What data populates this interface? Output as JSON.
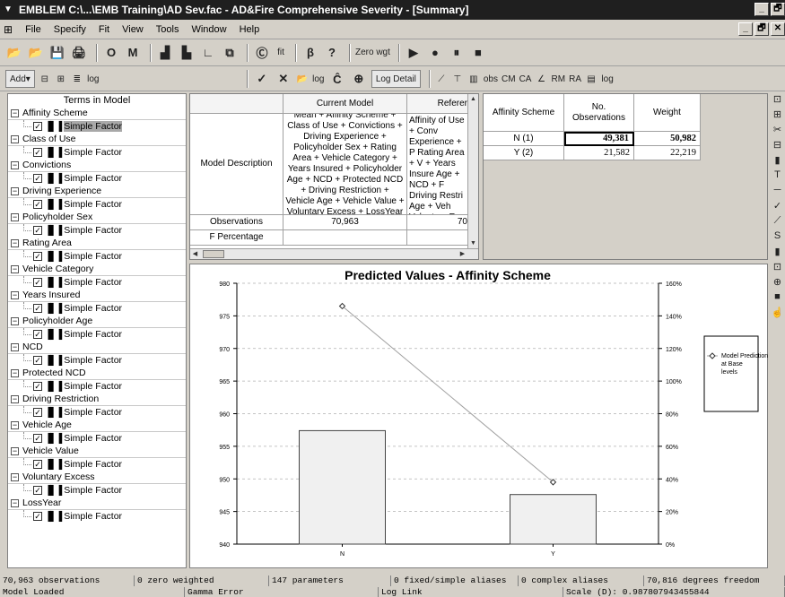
{
  "window": {
    "title": "EMBLEM C:\\...\\EMB Training\\AD Sev.fac - AD&Fire Comprehensive Severity - [Summary]",
    "controls": [
      "_",
      "🗗",
      "✕"
    ]
  },
  "menu": {
    "items": [
      "File",
      "Specify",
      "Fit",
      "View",
      "Tools",
      "Window",
      "Help"
    ],
    "mdi_controls": [
      "_",
      "🗗",
      "✕"
    ]
  },
  "toolbar1": {
    "buttons": [
      {
        "name": "open-icon",
        "glyph": "📂"
      },
      {
        "name": "open-alt-icon",
        "glyph": "📂"
      },
      {
        "name": "save-icon",
        "glyph": "💾"
      },
      {
        "name": "print-icon",
        "glyph": "🖨"
      },
      {
        "name": "o-button",
        "glyph": "O"
      },
      {
        "name": "m-button",
        "glyph": "M"
      },
      {
        "name": "chart-add-icon",
        "glyph": "▟"
      },
      {
        "name": "chart-sub-icon",
        "glyph": "▙"
      },
      {
        "name": "axis-icon",
        "glyph": "∟"
      },
      {
        "name": "copy-icon",
        "glyph": "⧉"
      },
      {
        "name": "c-button",
        "glyph": "Ⓒ"
      },
      {
        "name": "fit-button",
        "glyph": "fit"
      },
      {
        "name": "beta-icon",
        "glyph": "β"
      },
      {
        "name": "help-icon",
        "glyph": "?"
      },
      {
        "name": "zero-wgt-button",
        "glyph": "Zero wgt"
      },
      {
        "name": "play-icon",
        "glyph": "▶"
      },
      {
        "name": "record-icon",
        "glyph": "●"
      },
      {
        "name": "pause-icon",
        "glyph": "⏸"
      },
      {
        "name": "stop-icon",
        "glyph": "■"
      }
    ]
  },
  "toolbar2": {
    "add_label": "Add▾",
    "log_label": "log",
    "log_detail_label": "Log Detail",
    "obs_label": "obs",
    "cm_label": "CM",
    "ca_label": "CA",
    "rm_label": "RM",
    "ra_label": "RA",
    "log2_label": "log",
    "check_glyph": "✓",
    "cross_glyph": "✕",
    "c_hat_glyph": "Ĉ",
    "plus_glyph": "⊕"
  },
  "tree": {
    "title": "Terms in Model",
    "expander": "−",
    "check": "✓",
    "bars_glyph": "▐▌▐",
    "terms": [
      {
        "label": "Affinity Scheme",
        "child": "Simple Factor",
        "selected": true
      },
      {
        "label": "Class of Use",
        "child": "Simple Factor"
      },
      {
        "label": "Convictions",
        "child": "Simple Factor"
      },
      {
        "label": "Driving Experience",
        "child": "Simple Factor"
      },
      {
        "label": "Policyholder Sex",
        "child": "Simple Factor"
      },
      {
        "label": "Rating Area",
        "child": "Simple Factor"
      },
      {
        "label": "Vehicle Category",
        "child": "Simple Factor"
      },
      {
        "label": "Years Insured",
        "child": "Simple Factor"
      },
      {
        "label": "Policyholder Age",
        "child": "Simple Factor"
      },
      {
        "label": "NCD",
        "child": "Simple Factor"
      },
      {
        "label": "Protected NCD",
        "child": "Simple Factor"
      },
      {
        "label": "Driving Restriction",
        "child": "Simple Factor"
      },
      {
        "label": "Vehicle Age",
        "child": "Simple Factor"
      },
      {
        "label": "Vehicle Value",
        "child": "Simple Factor"
      },
      {
        "label": "Voluntary Excess",
        "child": "Simple Factor"
      },
      {
        "label": "LossYear",
        "child": "Simple Factor"
      }
    ]
  },
  "model_table": {
    "col_current": "Current Model",
    "col_reference": "Referer",
    "row_desc_label": "Model Description",
    "current_desc": "Mean + Affinity Scheme + Class of Use + Convictions + Driving Experience + Policyholder Sex + Rating Area + Vehicle Category + Years Insured + Policyholder Age + NCD + Protected NCD + Driving Restriction + Vehicle Age + Vehicle Value + Voluntary Excess + LossYear",
    "reference_desc": "Mean + Affinity of Use + Conv Experience + P Rating Area + V + Years Insure Age + NCD + F Driving Restri Age + Veh Voluntary Exc",
    "row_obs_label": "Observations",
    "obs_current": "70,963",
    "obs_reference": "70",
    "row_f_label": "F Percentage"
  },
  "obs_table": {
    "col_scheme": "Affinity Scheme",
    "col_obs": "No. Observations",
    "col_weight": "Weight",
    "rows": [
      {
        "level": "N (1)",
        "obs": "49,381",
        "weight": "50,982"
      },
      {
        "level": "Y (2)",
        "obs": "21,582",
        "weight": "22,219"
      }
    ]
  },
  "chart_data": {
    "type": "bar",
    "title": "Predicted Values - Affinity Scheme",
    "categories": [
      "N",
      "Y"
    ],
    "left_axis": {
      "ylim": [
        940,
        980
      ],
      "ticks": [
        940,
        945,
        950,
        955,
        960,
        965,
        970,
        975,
        980
      ]
    },
    "right_axis": {
      "ylim": [
        0,
        160
      ],
      "ticks": [
        "0%",
        "20%",
        "40%",
        "60%",
        "80%",
        "100%",
        "120%",
        "140%",
        "160%"
      ]
    },
    "series": [
      {
        "kind": "bar",
        "axis": "right",
        "values": [
          69.6,
          30.4
        ]
      },
      {
        "kind": "line",
        "axis": "left",
        "name": "Model Prediction at Base levels",
        "values": [
          976.5,
          949.5
        ]
      }
    ],
    "legend": {
      "position": "right",
      "entries": [
        "Model Prediction at Base levels"
      ]
    },
    "grid": true,
    "colors": {
      "bar_fill": "#f0f0f0",
      "bar_stroke": "#444444",
      "line": "#a0a0a0",
      "grid": "#b0b0b0"
    }
  },
  "status1": [
    "70,963 observations",
    "0 zero weighted",
    "147 parameters",
    "0 fixed/simple aliases",
    "0 complex aliases",
    "70,816 degrees freedom"
  ],
  "status2": [
    "Model Loaded",
    "Gamma Error",
    "Log Link",
    "Scale (D): 0.987807943455844"
  ]
}
